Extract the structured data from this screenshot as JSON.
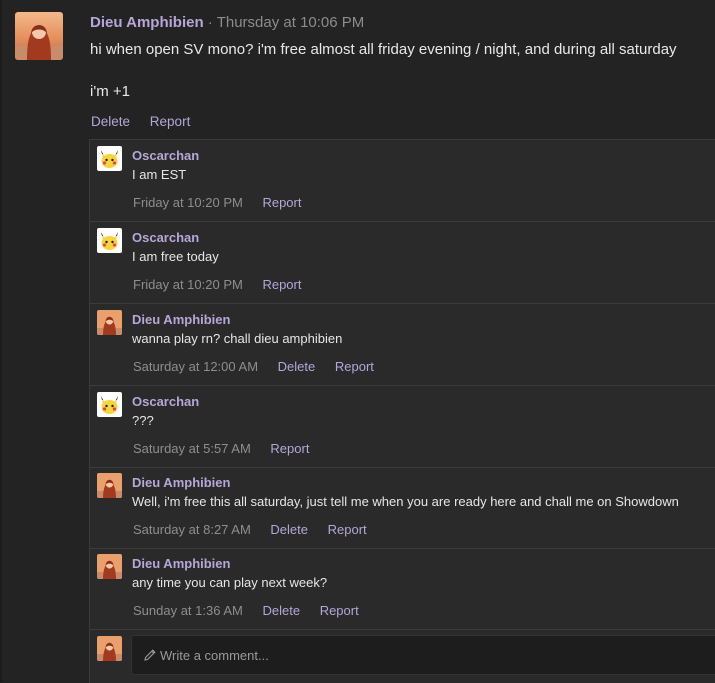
{
  "post": {
    "author": "Dieu Amphibien",
    "separator": "·",
    "time": "Thursday at 10:06 PM",
    "body_lines": [
      "hi when open SV mono? i'm free almost all friday evening / night, and during all saturday",
      "i'm +1"
    ],
    "actions": [
      "Delete",
      "Report"
    ]
  },
  "replies": [
    {
      "author": "Oscarchan",
      "avatar": "pikachu",
      "message": "I am EST",
      "time": "Friday at 10:20 PM",
      "actions": [
        "Report"
      ]
    },
    {
      "author": "Oscarchan",
      "avatar": "pikachu",
      "message": "I am free today",
      "time": "Friday at 10:20 PM",
      "actions": [
        "Report"
      ]
    },
    {
      "author": "Dieu Amphibien",
      "avatar": "dieu",
      "message": "wanna play rn? chall dieu amphibien",
      "time": "Saturday at 12:00 AM",
      "actions": [
        "Delete",
        "Report"
      ]
    },
    {
      "author": "Oscarchan",
      "avatar": "pikachu",
      "message": "???",
      "time": "Saturday at 5:57 AM",
      "actions": [
        "Report"
      ]
    },
    {
      "author": "Dieu Amphibien",
      "avatar": "dieu",
      "message": "Well, i'm free this all saturday, just tell me when you are ready here and chall me on Showdown",
      "time": "Saturday at 8:27 AM",
      "actions": [
        "Delete",
        "Report"
      ]
    },
    {
      "author": "Dieu Amphibien",
      "avatar": "dieu",
      "message": "any time you can play next week?",
      "time": "Sunday at 1:36 AM",
      "actions": [
        "Delete",
        "Report"
      ]
    }
  ],
  "comment": {
    "placeholder": "Write a comment..."
  },
  "colors": {
    "accent": "#b6a7d8",
    "background": "#232323",
    "replies_bg": "#2a2a2a"
  }
}
